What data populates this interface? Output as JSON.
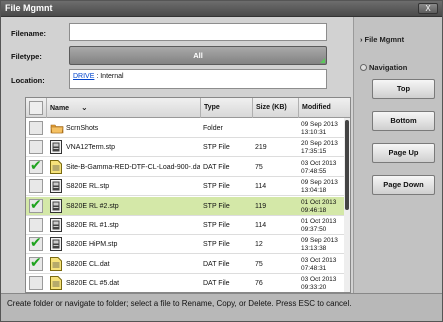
{
  "window": {
    "title": "File Mgmnt",
    "close_label": "X"
  },
  "form": {
    "filename_label": "Filename:",
    "filename_value": "",
    "filetype_label": "Filetype:",
    "filetype_value": "All",
    "location_label": "Location:",
    "location_drive": "DRIVE",
    "location_path": " : Internal"
  },
  "table": {
    "headers": {
      "name": "Name",
      "sort_icon": "chevron-down-icon",
      "type": "Type",
      "size": "Size (KB)",
      "modified": "Modified"
    },
    "rows": [
      {
        "checked": false,
        "icon": "folder-icon",
        "name": "ScrnShots",
        "type": "Folder",
        "size": "",
        "date": "09 Sep 2013",
        "time": "13:10:31",
        "selected": false
      },
      {
        "checked": false,
        "icon": "stp-file-icon",
        "name": "VNA12Term.stp",
        "type": "STP File",
        "size": "219",
        "date": "20 Sep 2013",
        "time": "17:35:15",
        "selected": false
      },
      {
        "checked": true,
        "icon": "dat-file-icon",
        "name": "Site-B-Gamma-RED-DTF-CL-Load-900-.dat",
        "type": "DAT File",
        "size": "75",
        "date": "03 Oct 2013",
        "time": "07:48:55",
        "selected": false
      },
      {
        "checked": false,
        "icon": "stp-file-icon",
        "name": "S820E RL.stp",
        "type": "STP File",
        "size": "114",
        "date": "09 Sep 2013",
        "time": "13:04:18",
        "selected": false
      },
      {
        "checked": true,
        "icon": "stp-file-icon",
        "name": "S820E RL #2.stp",
        "type": "STP File",
        "size": "119",
        "date": "01 Oct 2013",
        "time": "09:46:18",
        "selected": true
      },
      {
        "checked": false,
        "icon": "stp-file-icon",
        "name": "S820E RL #1.stp",
        "type": "STP File",
        "size": "114",
        "date": "01 Oct 2013",
        "time": "09:37:50",
        "selected": false
      },
      {
        "checked": true,
        "icon": "stp-file-icon",
        "name": "S820E HiPM.stp",
        "type": "STP File",
        "size": "12",
        "date": "09 Sep 2013",
        "time": "13:13:38",
        "selected": false
      },
      {
        "checked": true,
        "icon": "dat-file-icon",
        "name": "S820E CL.dat",
        "type": "DAT File",
        "size": "75",
        "date": "03 Oct 2013",
        "time": "07:48:31",
        "selected": false
      },
      {
        "checked": false,
        "icon": "dat-file-icon",
        "name": "S820E CL #5.dat",
        "type": "DAT File",
        "size": "76",
        "date": "03 Oct 2013",
        "time": "09:33:20",
        "selected": false
      }
    ]
  },
  "side": {
    "file_mgmnt_label": "File Mgmnt",
    "navigation_label": "Navigation",
    "top_label": "Top",
    "bottom_label": "Bottom",
    "page_up_label": "Page Up",
    "page_down_label": "Page Down"
  },
  "status": "Create folder or navigate to folder; select a file to Rename, Copy, or Delete. Press ESC to cancel.",
  "colors": {
    "selected_row": "#d4e8a8",
    "check": "#1fa31f",
    "link": "#0044cc"
  }
}
